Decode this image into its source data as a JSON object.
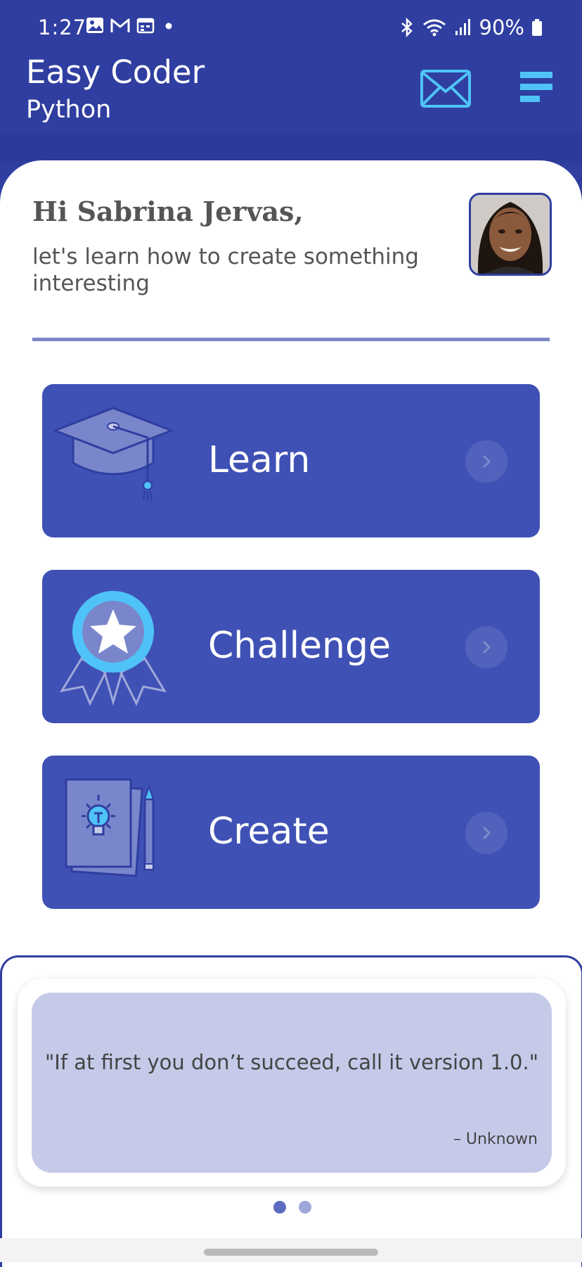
{
  "status_bar": {
    "time": "1:27",
    "battery": "90%",
    "left_icons": [
      "image-icon",
      "gmail-icon",
      "calendar-icon",
      "dot-icon"
    ],
    "right_icons": [
      "bluetooth-icon",
      "wifi-icon",
      "signal-icon",
      "battery-icon"
    ]
  },
  "header": {
    "title": "Easy Coder",
    "subtitle": "Python",
    "mail_icon": "mail-icon",
    "menu_icon": "menu-icon"
  },
  "greeting": {
    "title": "Hi Sabrina Jervas,",
    "subtitle": "let's learn how to create something interesting"
  },
  "menu": [
    {
      "label": "Learn",
      "icon": "graduation-cap-icon"
    },
    {
      "label": "Challenge",
      "icon": "award-badge-icon"
    },
    {
      "label": "Create",
      "icon": "idea-notebook-icon"
    }
  ],
  "quote": {
    "text": "\"If at first you don’t succeed, call it version 1.0.\"",
    "author": "– Unknown"
  },
  "pager": {
    "active_color": "#5c6bc0",
    "inactive_color": "#9fa8da"
  },
  "colors": {
    "primary": "#2f3ea0",
    "card": "#3f51b5",
    "accent": "#4fc3f7",
    "quote_bg": "#c5cae9"
  }
}
